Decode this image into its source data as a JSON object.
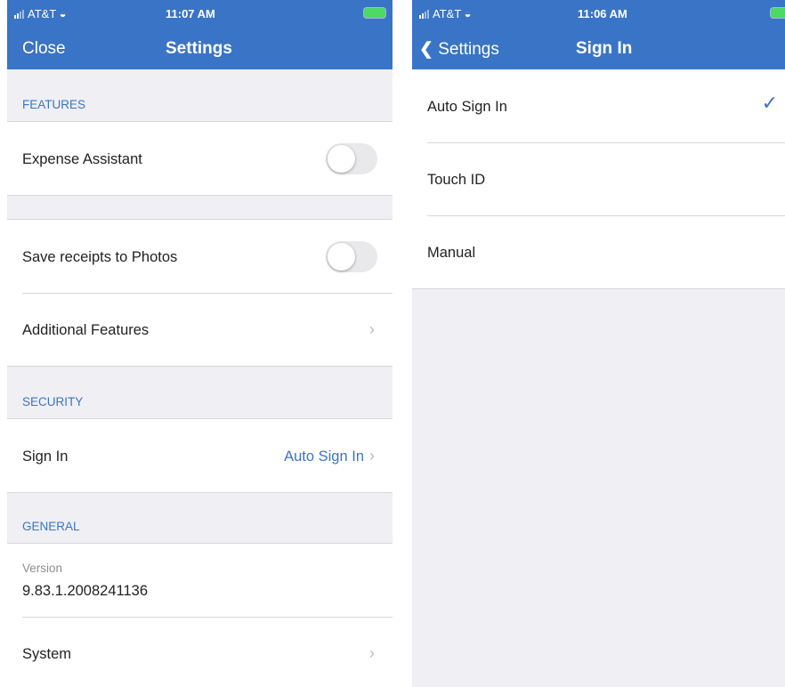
{
  "settings_screen": {
    "status": {
      "carrier": "AT&T",
      "time": "11:07 AM"
    },
    "nav": {
      "close_label": "Close",
      "title": "Settings"
    },
    "sections": {
      "features": "FEATURES",
      "security": "SECURITY",
      "general": "GENERAL"
    },
    "features": {
      "expense_assistant": {
        "label": "Expense Assistant",
        "enabled": false
      },
      "save_receipts": {
        "label": "Save receipts to Photos",
        "enabled": false
      },
      "additional": {
        "label": "Additional Features"
      }
    },
    "security": {
      "sign_in_label": "Sign In",
      "sign_in_value": "Auto Sign In"
    },
    "general": {
      "version_label": "Version",
      "version_value": "9.83.1.2008241136",
      "system_label": "System"
    },
    "colors": {
      "nav_bar": "#3a74c6",
      "accent": "#3a74c6"
    }
  },
  "signin_screen": {
    "status": {
      "carrier": "AT&T",
      "time": "11:06 AM"
    },
    "nav": {
      "back_label": "Settings",
      "title": "Sign In"
    },
    "options": [
      "Auto Sign In",
      "Touch ID",
      "Manual"
    ],
    "selected": "Auto Sign In"
  }
}
